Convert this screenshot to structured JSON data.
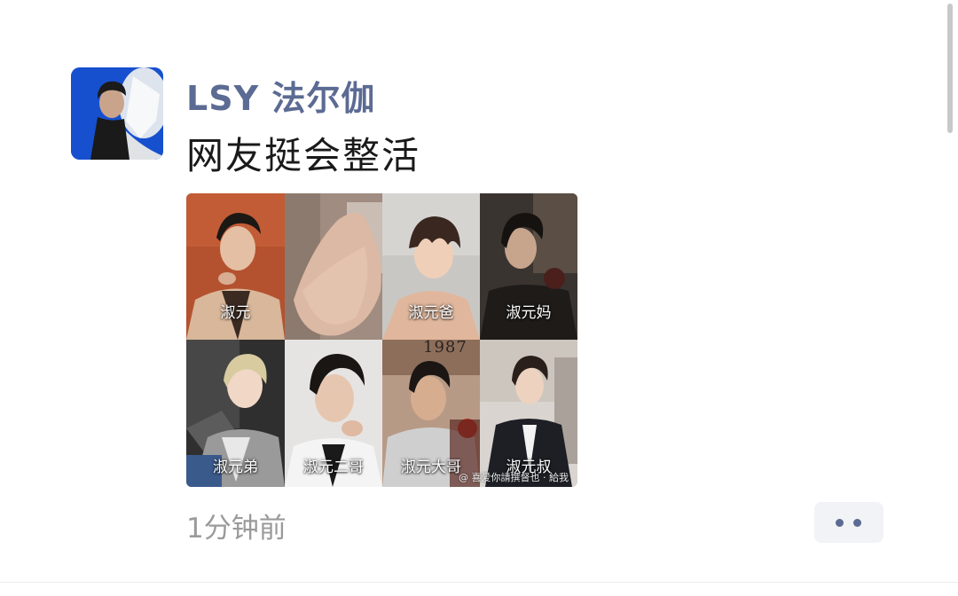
{
  "post": {
    "username": "LSY 法尔伽",
    "text": "网友挺会整活",
    "timestamp": "1分钟前",
    "images": [
      {
        "label": "淑元"
      },
      {
        "label": ""
      },
      {
        "label": "淑元爸"
      },
      {
        "label": "淑元妈"
      },
      {
        "label": "淑元弟"
      },
      {
        "label": "淑元二哥"
      },
      {
        "label": "淑元大哥"
      },
      {
        "label": "淑元叔"
      }
    ],
    "watermark": "@  喜爱你請撰督也 · 給我",
    "cell_print_text": "1987"
  },
  "icons": {
    "avatar": "user-avatar",
    "more": "more-dots-icon"
  },
  "colors": {
    "username": "#5b6b93",
    "text": "#1a1a1a",
    "timestamp": "#9a9a9a",
    "more_button_bg": "#f2f3f6"
  }
}
